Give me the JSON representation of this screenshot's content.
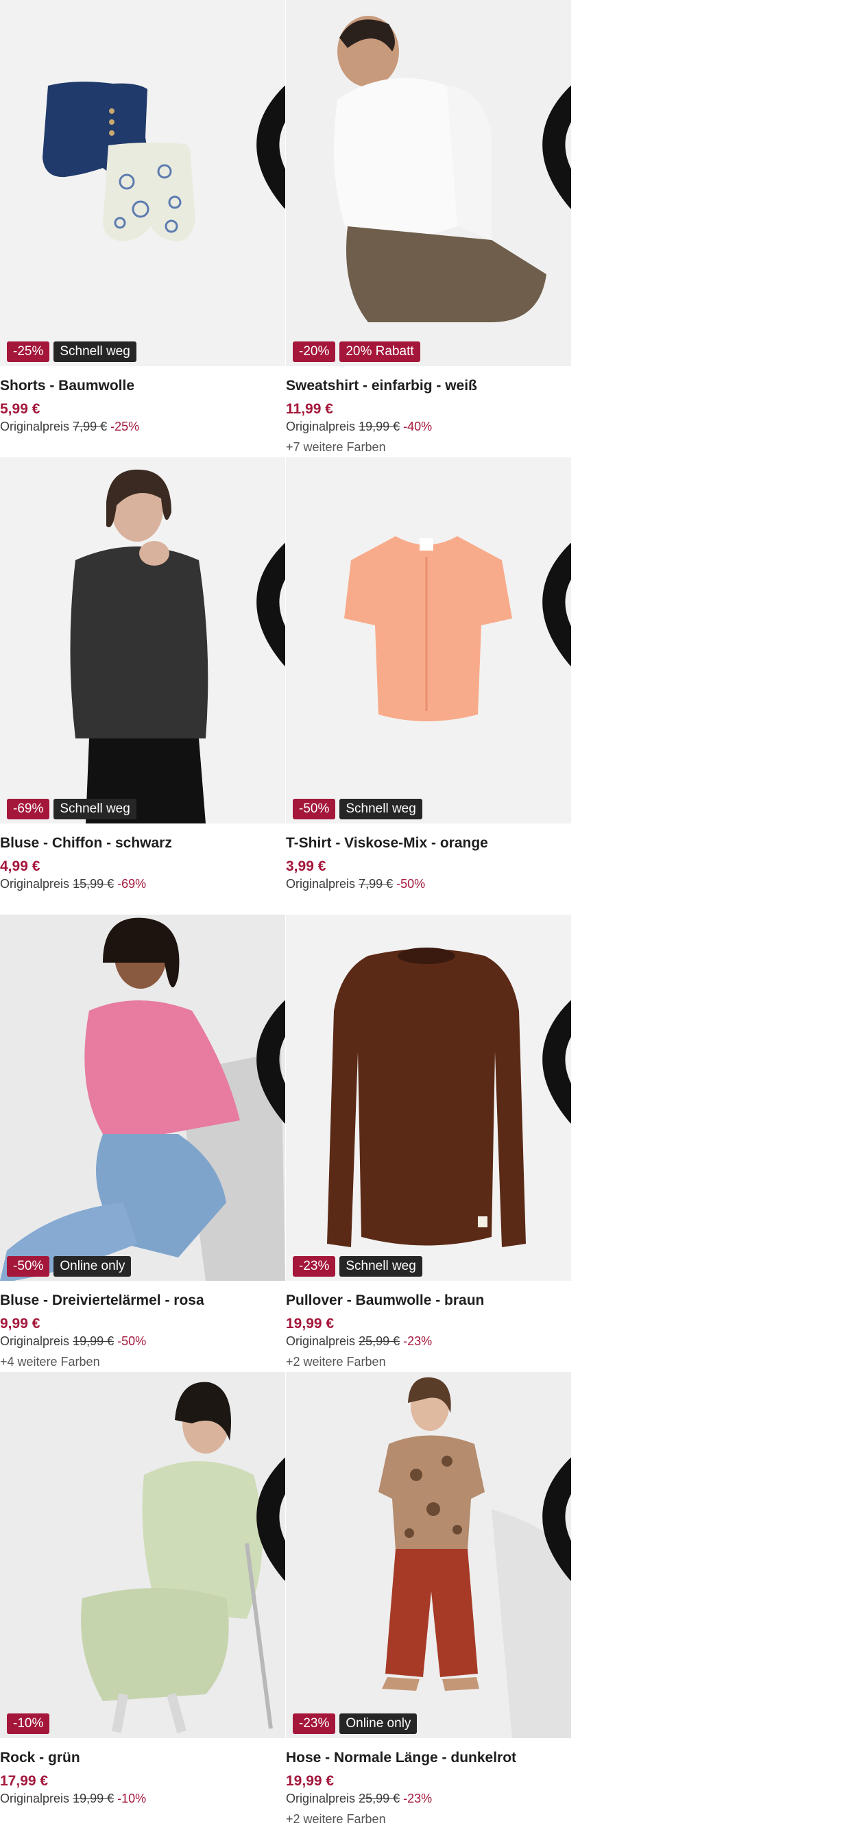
{
  "colors": {
    "accent": "#a4173b",
    "dark_badge": "#262626",
    "image_bg": "#f2f2f2"
  },
  "products": [
    {
      "title": "Shorts - Baumwolle",
      "price": "5,99 €",
      "orig_label": "Originalpreis",
      "orig_price": "7,99 €",
      "discount": "-25%",
      "badge_discount": "-25%",
      "badge_tag": "Schnell weg",
      "tag_color": "dark",
      "more_colors": ""
    },
    {
      "title": "Sweatshirt - einfarbig - weiß",
      "price": "11,99 €",
      "orig_label": "Originalpreis",
      "orig_price": "19,99 €",
      "discount": "-40%",
      "badge_discount": "-20%",
      "badge_tag": "20% Rabatt",
      "tag_color": "red",
      "more_colors": "+7 weitere Farben"
    },
    {
      "title": "Bluse - Chiffon - schwarz",
      "price": "4,99 €",
      "orig_label": "Originalpreis",
      "orig_price": "15,99 €",
      "discount": "-69%",
      "badge_discount": "-69%",
      "badge_tag": "Schnell weg",
      "tag_color": "dark",
      "more_colors": ""
    },
    {
      "title": "T-Shirt - Viskose-Mix - orange",
      "price": "3,99 €",
      "orig_label": "Originalpreis",
      "orig_price": "7,99 €",
      "discount": "-50%",
      "badge_discount": "-50%",
      "badge_tag": "Schnell weg",
      "tag_color": "dark",
      "more_colors": ""
    },
    {
      "title": "Bluse - Dreiviertelärmel - rosa",
      "price": "9,99 €",
      "orig_label": "Originalpreis",
      "orig_price": "19,99 €",
      "discount": "-50%",
      "badge_discount": "-50%",
      "badge_tag": "Online only",
      "tag_color": "dark",
      "more_colors": "+4 weitere Farben"
    },
    {
      "title": "Pullover - Baumwolle - braun",
      "price": "19,99 €",
      "orig_label": "Originalpreis",
      "orig_price": "25,99 €",
      "discount": "-23%",
      "badge_discount": "-23%",
      "badge_tag": "Schnell weg",
      "tag_color": "dark",
      "more_colors": "+2 weitere Farben"
    },
    {
      "title": "Rock - grün",
      "price": "17,99 €",
      "orig_label": "Originalpreis",
      "orig_price": "19,99 €",
      "discount": "-10%",
      "badge_discount": "-10%",
      "badge_tag": "",
      "tag_color": "dark",
      "more_colors": ""
    },
    {
      "title": "Hose - Normale Länge - dunkelrot",
      "price": "19,99 €",
      "orig_label": "Originalpreis",
      "orig_price": "25,99 €",
      "discount": "-23%",
      "badge_discount": "-23%",
      "badge_tag": "Online only",
      "tag_color": "dark",
      "more_colors": "+2 weitere Farben"
    }
  ]
}
